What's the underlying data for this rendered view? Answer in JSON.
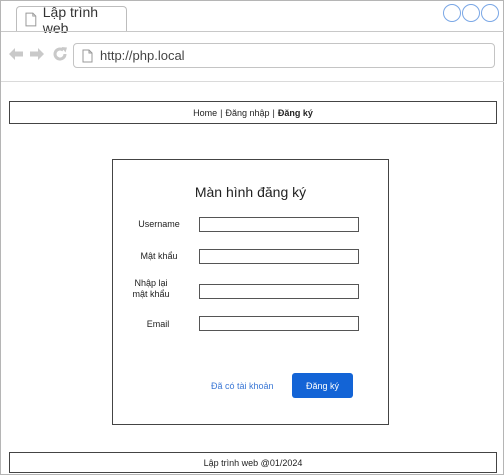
{
  "browser": {
    "tab_title": "Lập trình web",
    "url": "http://php.local",
    "accent_color": "#7aa7e6"
  },
  "nav": {
    "home": "Home",
    "separator": "|",
    "login": "Đăng nhập",
    "register": "Đăng ký",
    "active_item": "register"
  },
  "form": {
    "title": "Màn hình đăng ký",
    "username_label": "Username",
    "password_label": "Mật khẩu",
    "confirm_label_line1": "Nhập lại",
    "confirm_label_line2": "mật khẩu",
    "email_label": "Email",
    "username_value": "",
    "password_value": "",
    "confirm_value": "",
    "email_value": "",
    "have_account_link": "Đã có tài khoản",
    "submit_label": "Đăng ký",
    "submit_color": "#1364d6"
  },
  "footer": {
    "text": "Lập trình web @01/2024"
  }
}
